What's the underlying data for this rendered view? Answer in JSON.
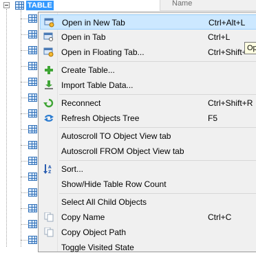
{
  "tree": {
    "node_label": "TABLE",
    "column_header": "Name",
    "tooltip_text": "Op"
  },
  "menu": {
    "items": [
      {
        "label": "Open in New Tab",
        "shortcut": "Ctrl+Alt+L",
        "icon": "open-new-tab-icon",
        "highlighted": true
      },
      {
        "label": "Open in Tab",
        "shortcut": "Ctrl+L",
        "icon": "open-tab-icon"
      },
      {
        "label": "Open in Floating Tab...",
        "shortcut": "Ctrl+Shift+",
        "icon": "floating-tab-icon"
      },
      {
        "label": "Create Table...",
        "shortcut": "",
        "icon": "plus-icon"
      },
      {
        "label": "Import Table Data...",
        "shortcut": "",
        "icon": "import-icon"
      },
      {
        "label": "Reconnect",
        "shortcut": "Ctrl+Shift+R",
        "icon": "reconnect-icon"
      },
      {
        "label": "Refresh Objects Tree",
        "shortcut": "F5",
        "icon": "refresh-icon"
      },
      {
        "label": "Autoscroll TO Object View tab",
        "shortcut": ""
      },
      {
        "label": "Autoscroll FROM Object View tab",
        "shortcut": ""
      },
      {
        "label": "Sort...",
        "shortcut": "",
        "icon": "sort-az-icon"
      },
      {
        "label": "Show/Hide Table Row Count",
        "shortcut": ""
      },
      {
        "label": "Select All Child Objects",
        "shortcut": ""
      },
      {
        "label": "Copy Name",
        "shortcut": "Ctrl+C",
        "icon": "copy-icon"
      },
      {
        "label": "Copy Object Path",
        "shortcut": "",
        "icon": "copy-path-icon"
      },
      {
        "label": "Toggle Visited State",
        "shortcut": ""
      }
    ]
  },
  "colors": {
    "menu_bg": "#f0f0f0",
    "highlight_bg": "#cce8ff",
    "highlight_border": "#99d1ff",
    "selection": "#3399ff"
  }
}
